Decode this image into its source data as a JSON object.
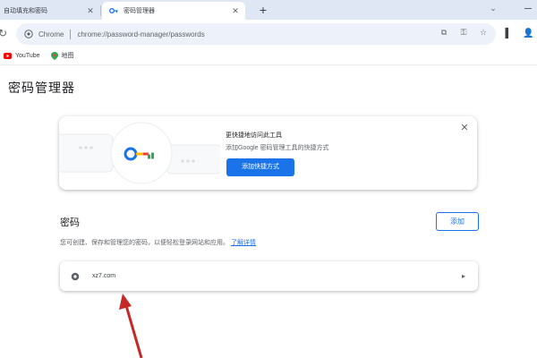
{
  "tabs": [
    {
      "label": "自动填充和密码",
      "active": false
    },
    {
      "label": "密码管理器",
      "active": true
    }
  ],
  "omnibox": {
    "scheme_label": "Chrome",
    "url": "chrome://password-manager/passwords"
  },
  "bookmarks": [
    {
      "label": "YouTube",
      "icon": "youtube-icon"
    },
    {
      "label": "地图",
      "icon": "maps-icon"
    }
  ],
  "page": {
    "title": "密码管理器"
  },
  "promo": {
    "title": "更快捷地访问此工具",
    "description": "添加Google 密码管理工具的快捷方式",
    "button_label": "添加快捷方式"
  },
  "passwords": {
    "section_title": "密码",
    "add_label": "添加",
    "description": "您可创建、保存和管理您的密码，以便轻松登录网站和应用。",
    "learn_more": "了解详情",
    "items": [
      {
        "site": "xz7.com"
      }
    ]
  },
  "colors": {
    "accent": "#1a73e8",
    "tabstrip": "#dfe7f5",
    "omnibox": "#edf2fa",
    "annotation_arrow": "#c62828"
  }
}
